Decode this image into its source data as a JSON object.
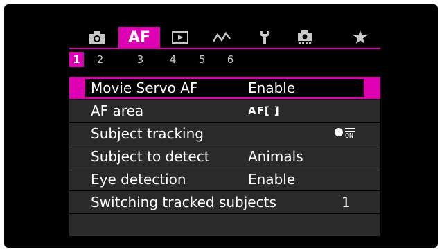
{
  "tabs": [
    {
      "name": "camera-tab-icon",
      "kind": "icon"
    },
    {
      "name": "af-tab",
      "label": "AF",
      "active": true
    },
    {
      "name": "playback-tab-icon",
      "kind": "icon"
    },
    {
      "name": "wireless-tab-icon",
      "kind": "icon"
    },
    {
      "name": "setup-tab-icon",
      "kind": "icon"
    },
    {
      "name": "custom-functions-tab-icon",
      "kind": "icon"
    },
    {
      "name": "my-menu-star-icon",
      "kind": "icon"
    }
  ],
  "pages": [
    "1",
    "2",
    "3",
    "4",
    "5",
    "6"
  ],
  "active_page": "1",
  "menu": {
    "items": [
      {
        "label": "Movie Servo AF",
        "value": "Enable"
      },
      {
        "label": "AF area",
        "value": "AF[ ]"
      },
      {
        "label": "Subject tracking",
        "value_icon": "subject-tracking-on-icon",
        "value": "ON"
      },
      {
        "label": "Subject to detect",
        "value": "Animals"
      },
      {
        "label": "Eye detection",
        "value": "Enable"
      },
      {
        "label": "Switching tracked subjects",
        "value": "1"
      }
    ]
  },
  "colors": {
    "accent": "#e000b4",
    "row_bg": "#2a2a2a",
    "screen_bg": "#000000"
  }
}
